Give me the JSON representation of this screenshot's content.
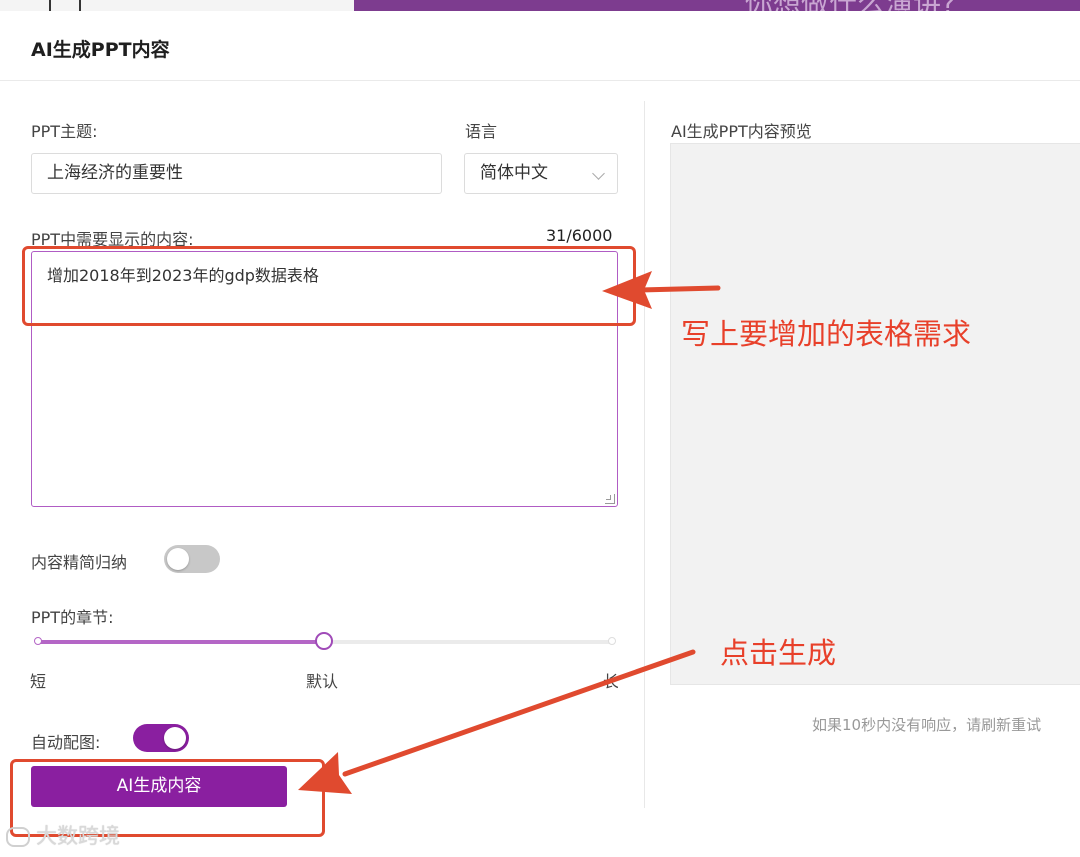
{
  "background_page": {
    "banner_text": "你想做什么演讲?"
  },
  "dialog": {
    "title": "AI生成PPT内容"
  },
  "form": {
    "topic_label": "PPT主题:",
    "topic_value": "上海经济的重要性",
    "language_label": "语言",
    "language_value": "简体中文",
    "content_label": "PPT中需要显示的内容:",
    "content_counter": "31/6000",
    "content_value": "增加2018年到2023年的gdp数据表格",
    "summarize_label": "内容精简归纳",
    "summarize_on": false,
    "chapters_label": "PPT的章节:",
    "chapters_options": [
      "短",
      "默认",
      "长"
    ],
    "chapters_selected": "默认",
    "auto_image_label": "自动配图:",
    "auto_image_on": true,
    "generate_button": "AI生成内容"
  },
  "preview": {
    "title": "AI生成PPT内容预览",
    "hint": "如果10秒内没有响应，请刷新重试"
  },
  "annotations": {
    "table_note": "写上要增加的表格需求",
    "click_note": "点击生成"
  },
  "watermark": "大数跨境",
  "colors": {
    "accent": "#8a1fa0",
    "annotation_red": "#e04a2f",
    "slider_fill": "#b466c6"
  },
  "icons": {
    "dropdown": "chevron-down-icon",
    "resize": "resize-grip-icon"
  }
}
